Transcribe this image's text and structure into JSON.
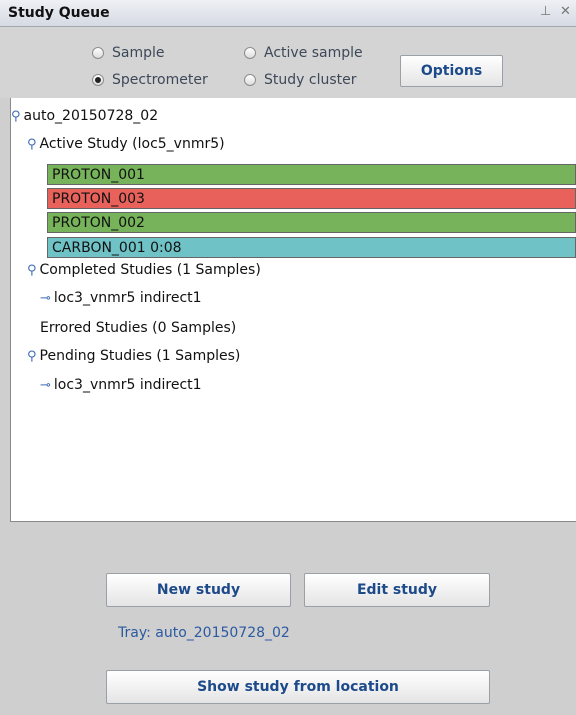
{
  "window": {
    "title": "Study Queue",
    "pin_glyph": "⊥",
    "close_glyph": "✕"
  },
  "options": {
    "radios": [
      {
        "label": "Sample",
        "selected": false
      },
      {
        "label": "Active sample",
        "selected": false
      },
      {
        "label": "Spectrometer",
        "selected": true
      },
      {
        "label": "Study cluster",
        "selected": false
      }
    ],
    "options_button": "Options"
  },
  "tree": {
    "root": "auto_20150728_02",
    "active": {
      "label": "Active Study (loc5_vnmr5)",
      "items": [
        {
          "label": "PROTON_001",
          "color": "#76b35a"
        },
        {
          "label": "PROTON_003",
          "color": "#e8625b"
        },
        {
          "label": "PROTON_002",
          "color": "#76b35a"
        },
        {
          "label": "CARBON_001 0:08",
          "color": "#6fc3c6"
        }
      ]
    },
    "completed": {
      "label": "Completed Studies (1 Samples)",
      "child": "loc3_vnmr5 indirect1"
    },
    "errored": {
      "label": "Errored Studies (0 Samples)"
    },
    "pending": {
      "label": "Pending Studies (1 Samples)",
      "child": "loc3_vnmr5 indirect1"
    }
  },
  "actions": {
    "new_study": "New study",
    "edit_study": "Edit study",
    "tray": "Tray: auto_20150728_02",
    "show_study": "Show study from location"
  }
}
